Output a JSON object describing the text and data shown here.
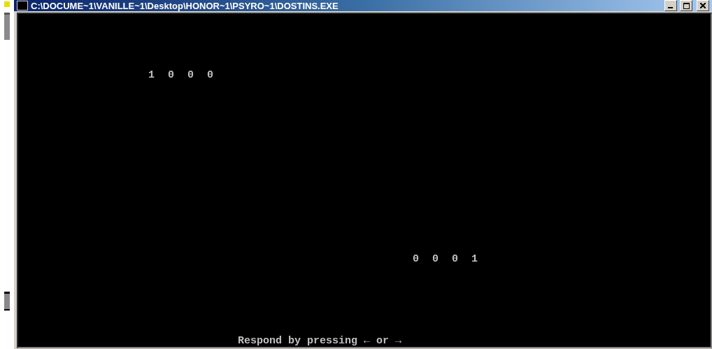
{
  "window": {
    "title": "C:\\DOCUME~1\\VANILLE~1\\Desktop\\HONOR~1\\PSYRO~1\\DOSTINS.EXE"
  },
  "console": {
    "top_pattern": "1 0 0 0",
    "bottom_pattern": "0 0 0 1",
    "prompt": "Respond by pressing ← or →"
  }
}
